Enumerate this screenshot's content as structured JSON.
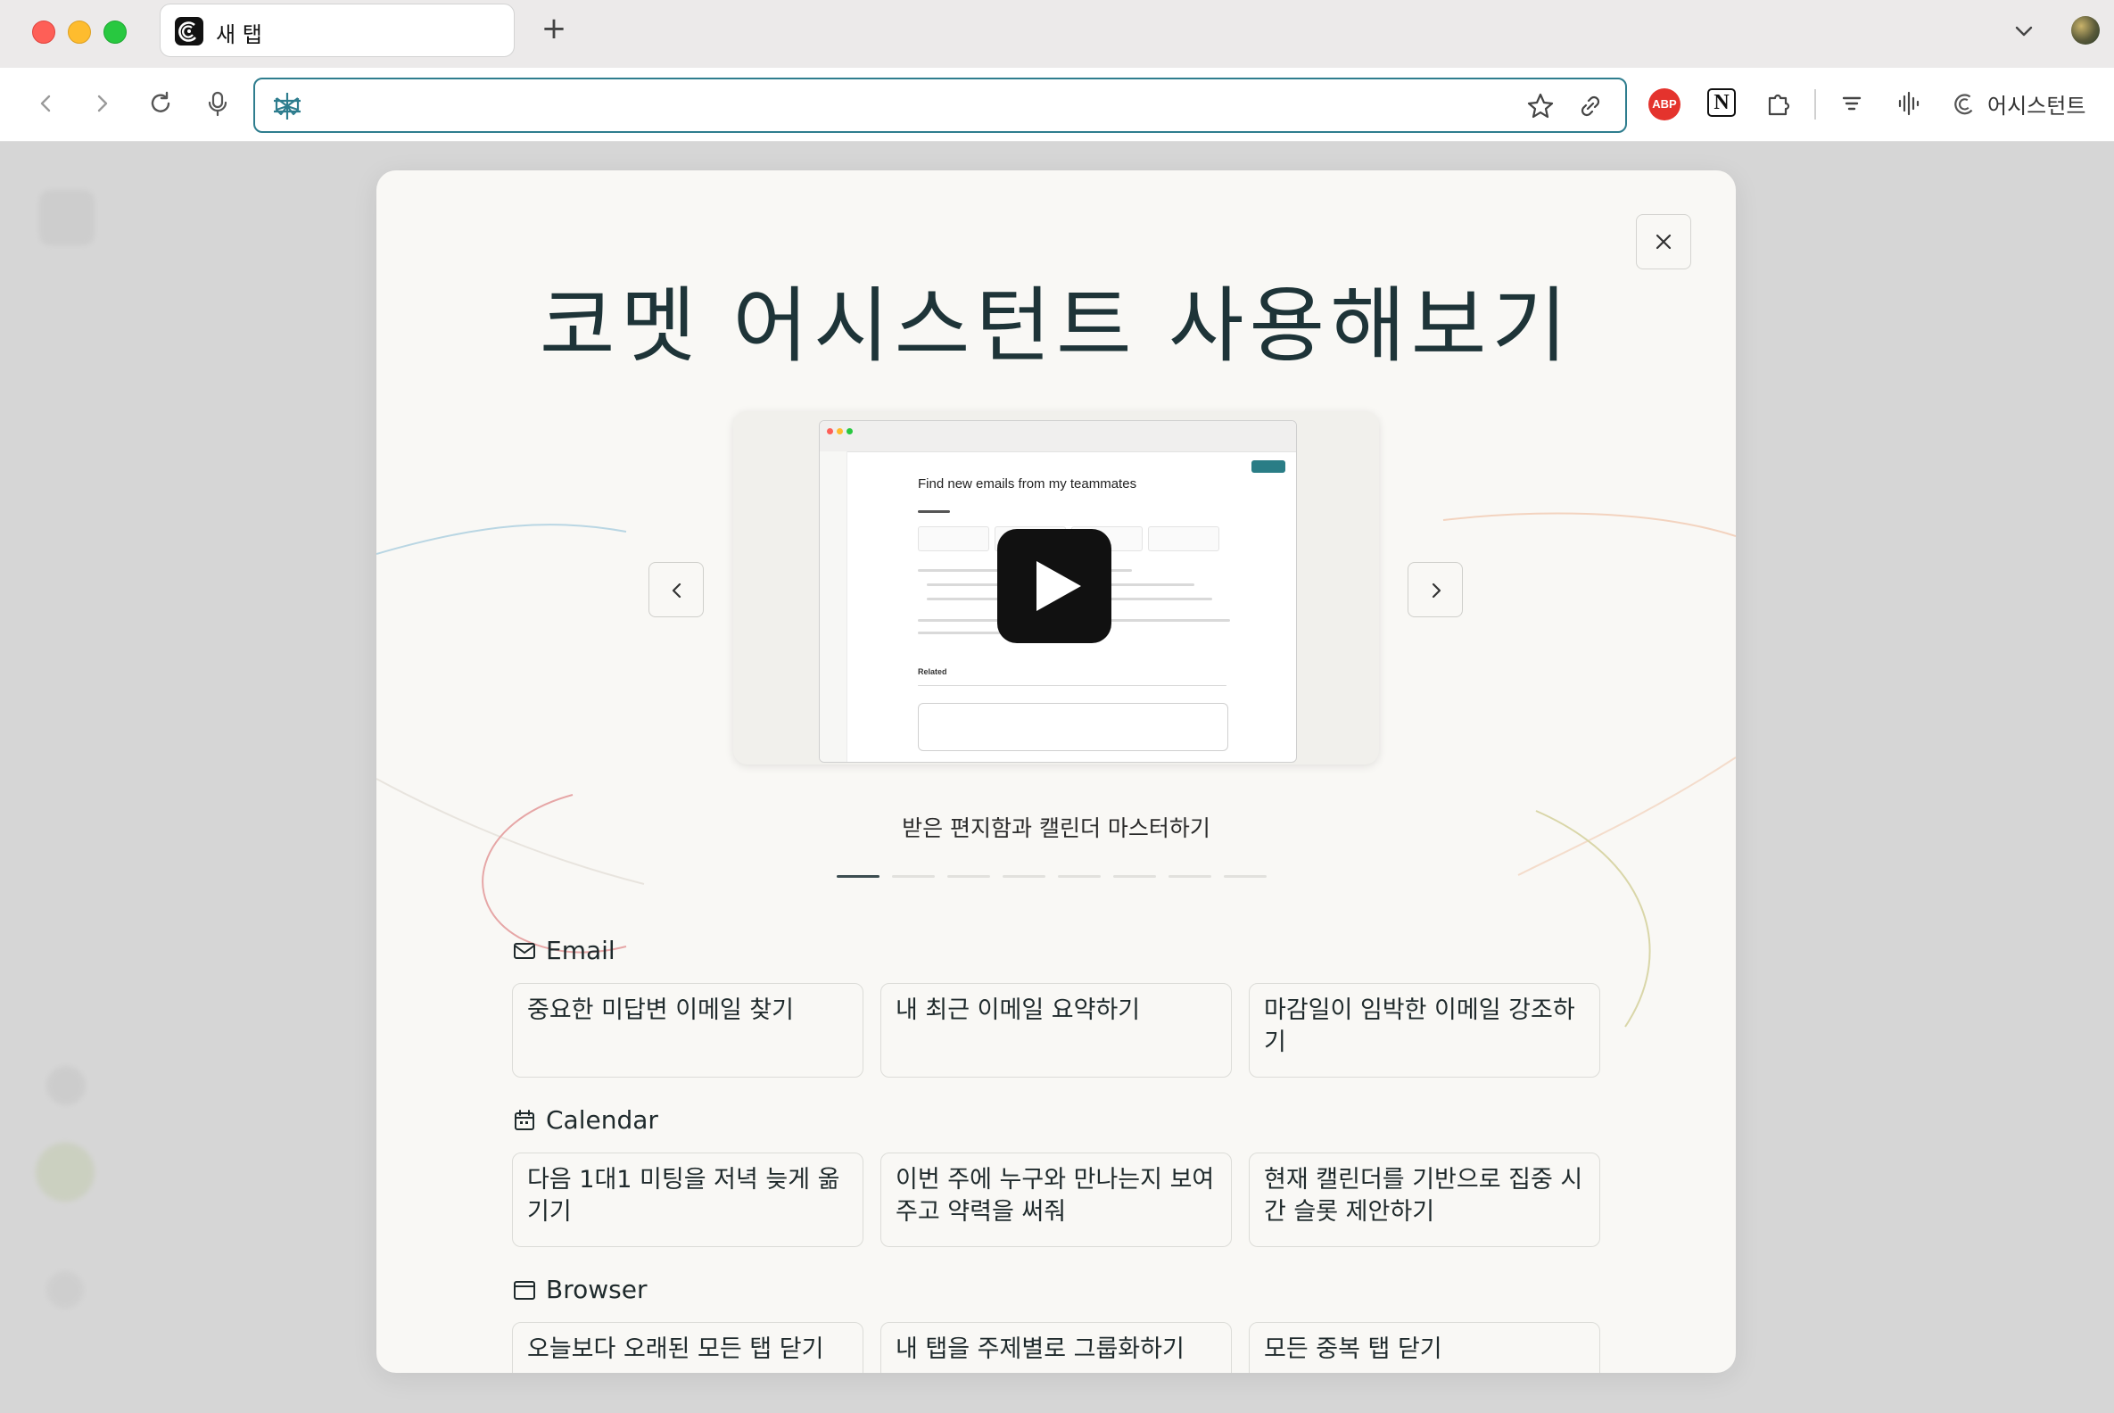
{
  "browser": {
    "tab_title": "새 탭",
    "new_tab_symbol": "+",
    "omnibox": {
      "value": "",
      "placeholder": ""
    },
    "extensions": {
      "abp_label": "ABP",
      "notion_label": "N"
    },
    "assistant_label": "어시스턴트"
  },
  "modal": {
    "title": "코멧 어시스턴트 사용해보기",
    "video": {
      "screenshot_title": "Find new emails from my teammates",
      "related_label": "Related"
    },
    "caption": "받은 편지함과 캘린더 마스터하기",
    "carousel": {
      "total": 8,
      "active": 1
    },
    "sections": [
      {
        "label": "Email",
        "icon": "mail-icon",
        "items": [
          "중요한 미답변 이메일 찾기",
          "내 최근 이메일 요약하기",
          "마감일이 임박한 이메일 강조하기"
        ]
      },
      {
        "label": "Calendar",
        "icon": "calendar-icon",
        "items": [
          "다음 1대1 미팅을 저녁 늦게 옮기기",
          "이번 주에 누구와 만나는지 보여주고 약력을 써줘",
          "현재 캘린더를 기반으로 집중 시간 슬롯 제안하기"
        ]
      },
      {
        "label": "Browser",
        "icon": "browser-window-icon",
        "items": [
          "오늘보다 오래된 모든 탭 닫기",
          "내 탭을 주제별로 그룹화하기",
          "모든 중복 탭 닫기"
        ]
      }
    ]
  },
  "colors": {
    "accent": "#2e7d8e",
    "modal_bg": "#f9f8f5",
    "heading": "#1e3438",
    "abp_red": "#e4332d"
  }
}
